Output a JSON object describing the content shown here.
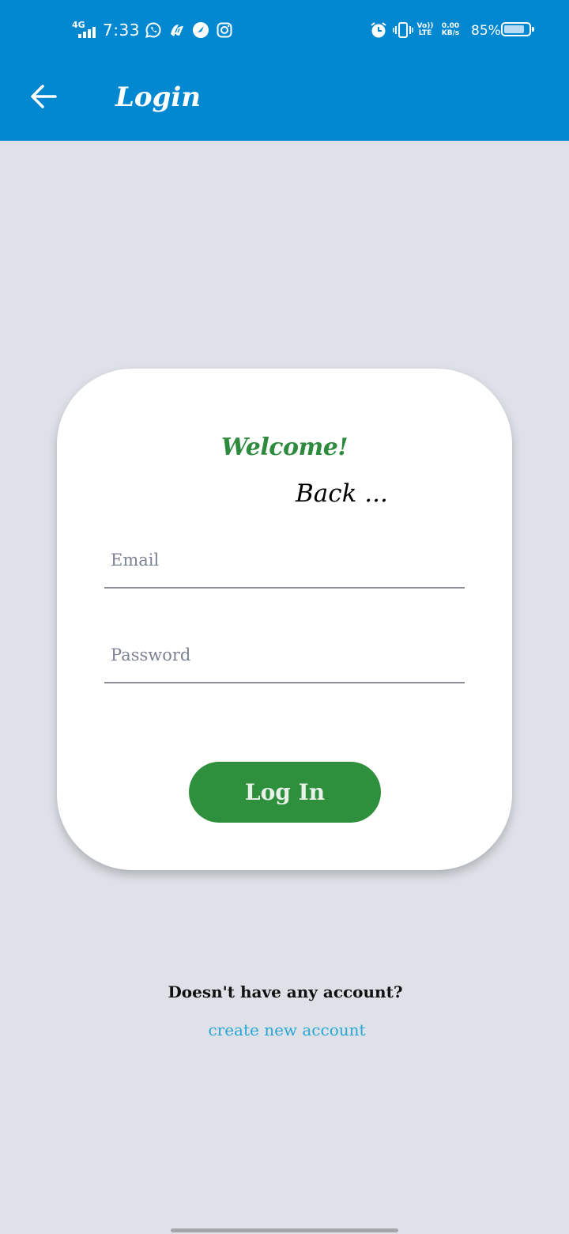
{
  "status_bar": {
    "network_type": "4G",
    "time": "7:33",
    "volte_top": "Vo))",
    "volte_bottom": "LTE",
    "speed_value": "0.00",
    "speed_unit": "KB/s",
    "battery_percent": "85%",
    "battery_level": 0.85,
    "left_icons": [
      "whatsapp-icon",
      "app-icon",
      "speedometer-icon",
      "instagram-icon"
    ],
    "right_icons": [
      "alarm-icon",
      "vibrate-icon"
    ]
  },
  "toolbar": {
    "title": "Login",
    "back_icon": "arrow-left-icon",
    "color": "#0288d1"
  },
  "card": {
    "welcome": "Welcome!",
    "back_text": "Back ...",
    "email_placeholder": "Email",
    "email_value": "",
    "password_placeholder": "Password",
    "password_value": "",
    "login_label": "Log In",
    "accent_color": "#2e8f3c"
  },
  "footer": {
    "question": "Doesn't have any account?",
    "create_link": "create new account",
    "link_color": "#29a6d6"
  }
}
